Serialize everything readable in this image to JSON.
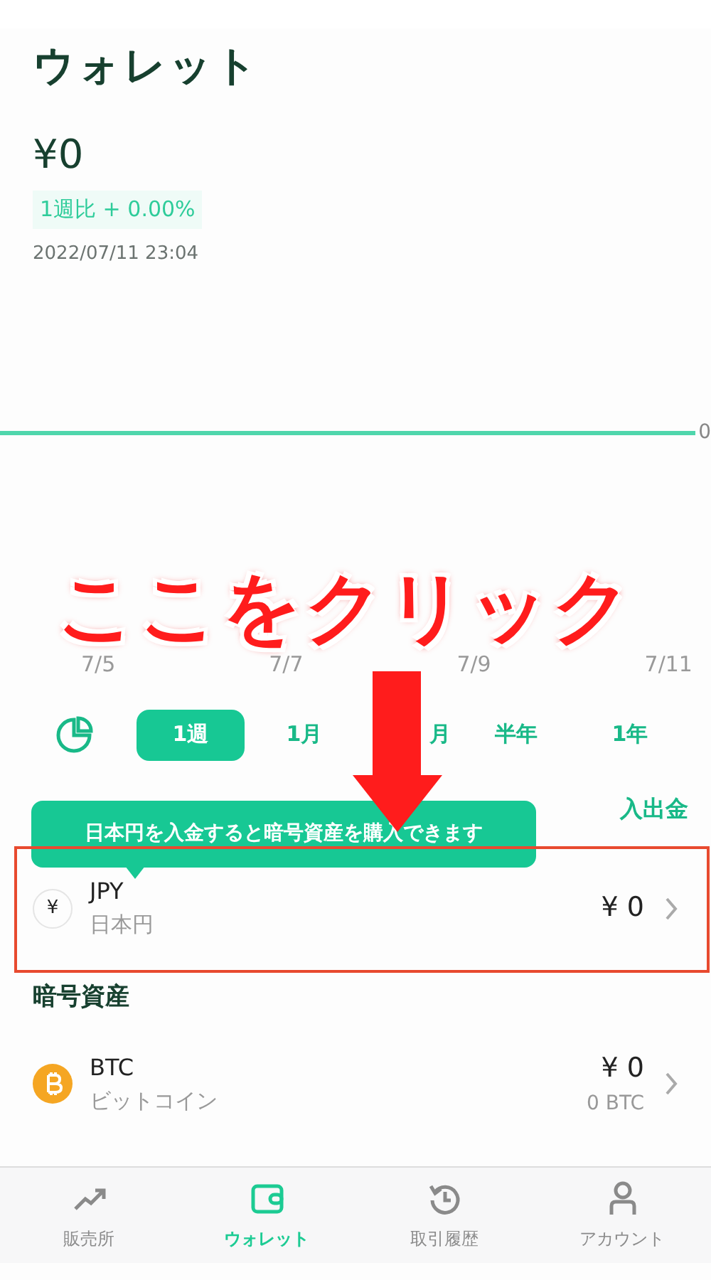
{
  "screen": {
    "title": "ウォレット"
  },
  "balance": {
    "amount": "¥0",
    "change": "1週比 + 0.00%",
    "timestamp": "2022/07/11 23:04"
  },
  "chart": {
    "y_label": "0",
    "x_labels": [
      "7/5",
      "7/7",
      "7/9",
      "7/11"
    ]
  },
  "periods": [
    {
      "label": "1週",
      "selected": true
    },
    {
      "label": "1月",
      "selected": false
    },
    {
      "label": "月",
      "selected": false
    },
    {
      "label": "半年",
      "selected": false
    },
    {
      "label": "1年",
      "selected": false
    }
  ],
  "deposit_link": "入出金",
  "tooltip": "日本円を入金すると暗号資産を購入できます",
  "fiat": {
    "symbol": "¥",
    "code": "JPY",
    "name": "日本円",
    "amount": "¥ 0"
  },
  "crypto_heading": "暗号資産",
  "crypto": [
    {
      "code": "BTC",
      "name": "ビットコイン",
      "amount": "¥ 0",
      "quantity": "0 BTC"
    }
  ],
  "nav": [
    {
      "kind": "chart",
      "label": "販売所",
      "selected": false
    },
    {
      "kind": "wallet",
      "label": "ウォレット",
      "selected": true
    },
    {
      "kind": "history",
      "label": "取引履歴",
      "selected": false
    },
    {
      "kind": "account",
      "label": "アカウント",
      "selected": false
    }
  ],
  "annotation": {
    "caption": "ここをクリック"
  }
}
